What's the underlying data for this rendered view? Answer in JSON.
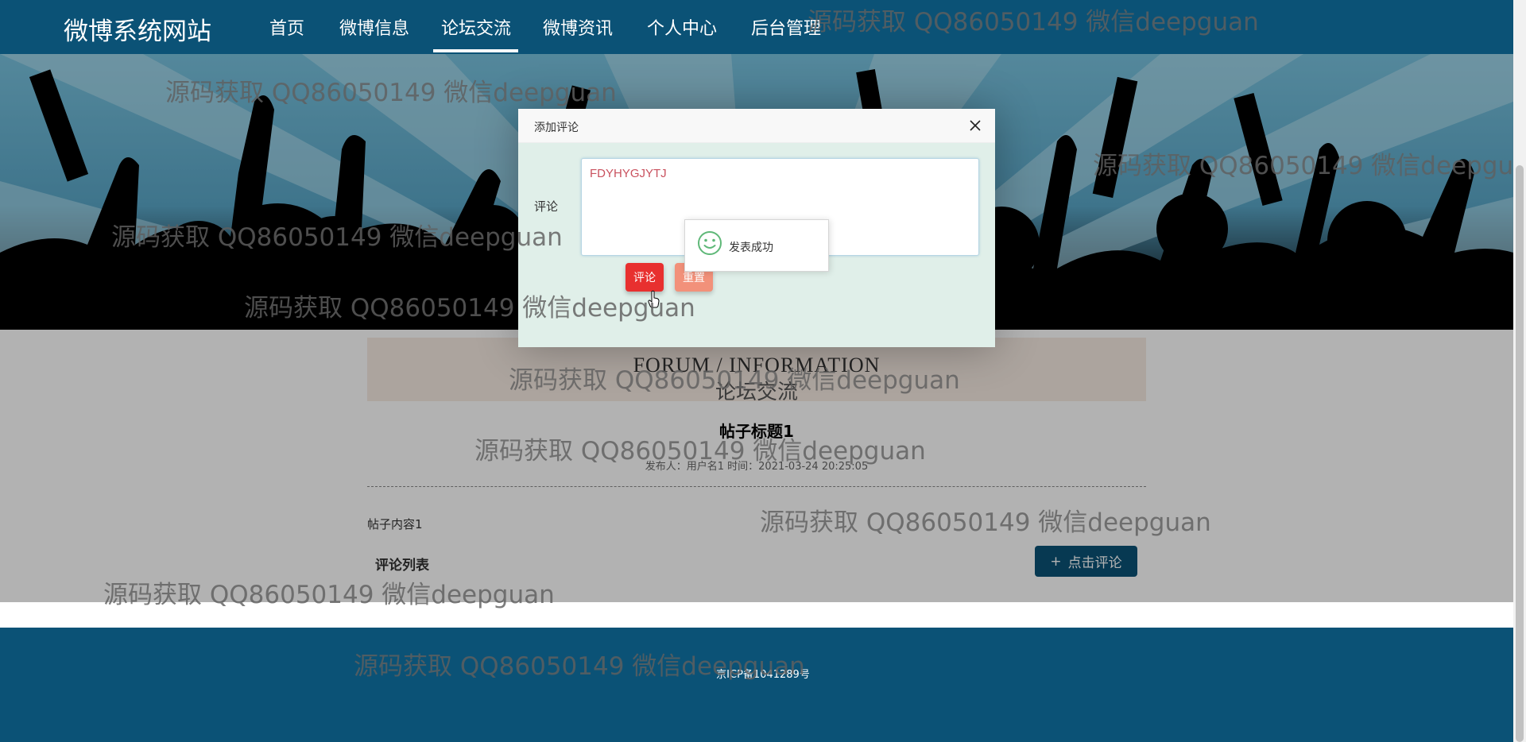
{
  "site": {
    "brand": "微博系统网站",
    "nav": [
      "首页",
      "微博信息",
      "论坛交流",
      "微博资讯",
      "个人中心",
      "后台管理"
    ],
    "active_nav": "论坛交流"
  },
  "page": {
    "heading_en": "FORUM / INFORMATION",
    "heading_cn": "论坛交流",
    "post_title": "帖子标题1",
    "post_meta": "发布人：用户名1 时间：2021-03-24 20:25:05",
    "post_content": "帖子内容1",
    "comments_heading": "评论列表",
    "comment_button": "点击评论"
  },
  "footer": {
    "icp": "京ICP备1041289号"
  },
  "modal": {
    "title": "添加评论",
    "field_label": "评论",
    "field_value": "FDYHYGJYTJ",
    "submit_label": "评论",
    "reset_label": "重置"
  },
  "toast": {
    "message": "发表成功"
  },
  "watermark": "源码获取 QQ86050149 微信deepguan",
  "colors": {
    "primary": "#0b5276",
    "danger": "#e8302f",
    "warm": "#f2917a",
    "success_icon": "#5fb878",
    "input_text": "#c9515e"
  }
}
